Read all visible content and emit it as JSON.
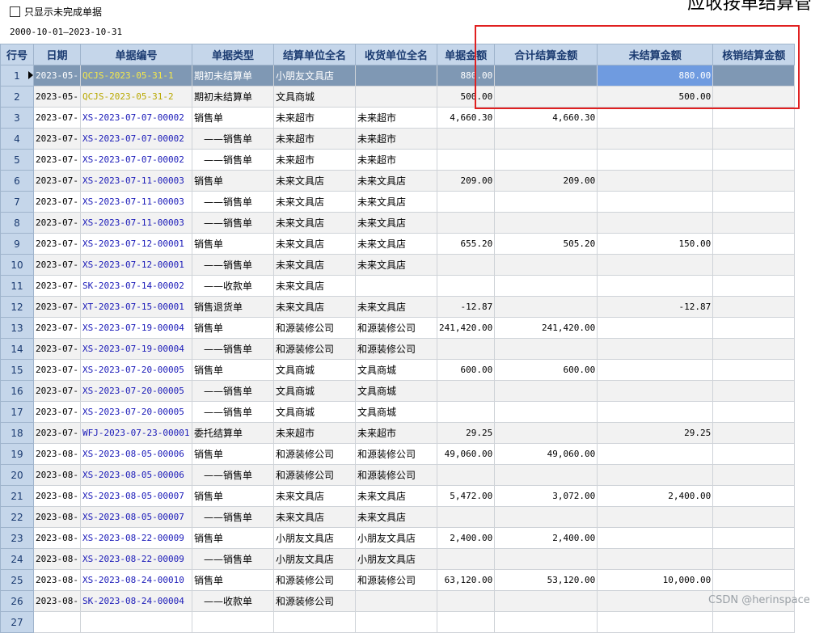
{
  "filter": {
    "checkbox_label": "只显示未完成单据",
    "checked": false,
    "date_range": "2000-10-01—2023-10-31"
  },
  "page_title_partial": "应收按单结算管",
  "columns": [
    "行号",
    "日期",
    "单据编号",
    "单据类型",
    "结算单位全名",
    "收货单位全名",
    "单据金额",
    "合计结算金额",
    "未结算金额",
    "核销结算金额"
  ],
  "rows": [
    {
      "n": "1",
      "date": "2023-05-",
      "code": "QCJS-2023-05-31-1",
      "type": "期初未结算单",
      "unit": "小朋友文具店",
      "recv": "",
      "amount": "880.00",
      "settled": "",
      "unsettled": "880.00",
      "writeoff": ""
    },
    {
      "n": "2",
      "date": "2023-05-",
      "code": "QCJS-2023-05-31-2",
      "type": "期初未结算单",
      "unit": "文具商城",
      "recv": "",
      "amount": "500.00",
      "settled": "",
      "unsettled": "500.00",
      "writeoff": ""
    },
    {
      "n": "3",
      "date": "2023-07-",
      "code": "XS-2023-07-07-00002",
      "type": "销售单",
      "unit": "未来超市",
      "recv": "未来超市",
      "amount": "4,660.30",
      "settled": "4,660.30",
      "unsettled": "",
      "writeoff": ""
    },
    {
      "n": "4",
      "date": "2023-07-",
      "code": "XS-2023-07-07-00002",
      "type": "——销售单",
      "unit": "未来超市",
      "recv": "未来超市",
      "amount": "",
      "settled": "",
      "unsettled": "",
      "writeoff": ""
    },
    {
      "n": "5",
      "date": "2023-07-",
      "code": "XS-2023-07-07-00002",
      "type": "——销售单",
      "unit": "未来超市",
      "recv": "未来超市",
      "amount": "",
      "settled": "",
      "unsettled": "",
      "writeoff": ""
    },
    {
      "n": "6",
      "date": "2023-07-",
      "code": "XS-2023-07-11-00003",
      "type": "销售单",
      "unit": "未来文具店",
      "recv": "未来文具店",
      "amount": "209.00",
      "settled": "209.00",
      "unsettled": "",
      "writeoff": ""
    },
    {
      "n": "7",
      "date": "2023-07-",
      "code": "XS-2023-07-11-00003",
      "type": "——销售单",
      "unit": "未来文具店",
      "recv": "未来文具店",
      "amount": "",
      "settled": "",
      "unsettled": "",
      "writeoff": ""
    },
    {
      "n": "8",
      "date": "2023-07-",
      "code": "XS-2023-07-11-00003",
      "type": "——销售单",
      "unit": "未来文具店",
      "recv": "未来文具店",
      "amount": "",
      "settled": "",
      "unsettled": "",
      "writeoff": ""
    },
    {
      "n": "9",
      "date": "2023-07-",
      "code": "XS-2023-07-12-00001",
      "type": "销售单",
      "unit": "未来文具店",
      "recv": "未来文具店",
      "amount": "655.20",
      "settled": "505.20",
      "unsettled": "150.00",
      "writeoff": ""
    },
    {
      "n": "10",
      "date": "2023-07-",
      "code": "XS-2023-07-12-00001",
      "type": "——销售单",
      "unit": "未来文具店",
      "recv": "未来文具店",
      "amount": "",
      "settled": "",
      "unsettled": "",
      "writeoff": ""
    },
    {
      "n": "11",
      "date": "2023-07-",
      "code": "SK-2023-07-14-00002",
      "type": "——收款单",
      "unit": "未来文具店",
      "recv": "",
      "amount": "",
      "settled": "",
      "unsettled": "",
      "writeoff": ""
    },
    {
      "n": "12",
      "date": "2023-07-",
      "code": "XT-2023-07-15-00001",
      "type": "销售退货单",
      "unit": "未来文具店",
      "recv": "未来文具店",
      "amount": "-12.87",
      "settled": "",
      "unsettled": "-12.87",
      "writeoff": ""
    },
    {
      "n": "13",
      "date": "2023-07-",
      "code": "XS-2023-07-19-00004",
      "type": "销售单",
      "unit": "和源装修公司",
      "recv": "和源装修公司",
      "amount": "241,420.00",
      "settled": "241,420.00",
      "unsettled": "",
      "writeoff": ""
    },
    {
      "n": "14",
      "date": "2023-07-",
      "code": "XS-2023-07-19-00004",
      "type": "——销售单",
      "unit": "和源装修公司",
      "recv": "和源装修公司",
      "amount": "",
      "settled": "",
      "unsettled": "",
      "writeoff": ""
    },
    {
      "n": "15",
      "date": "2023-07-",
      "code": "XS-2023-07-20-00005",
      "type": "销售单",
      "unit": "文具商城",
      "recv": "文具商城",
      "amount": "600.00",
      "settled": "600.00",
      "unsettled": "",
      "writeoff": ""
    },
    {
      "n": "16",
      "date": "2023-07-",
      "code": "XS-2023-07-20-00005",
      "type": "——销售单",
      "unit": "文具商城",
      "recv": "文具商城",
      "amount": "",
      "settled": "",
      "unsettled": "",
      "writeoff": ""
    },
    {
      "n": "17",
      "date": "2023-07-",
      "code": "XS-2023-07-20-00005",
      "type": "——销售单",
      "unit": "文具商城",
      "recv": "文具商城",
      "amount": "",
      "settled": "",
      "unsettled": "",
      "writeoff": ""
    },
    {
      "n": "18",
      "date": "2023-07-",
      "code": "WFJ-2023-07-23-00001",
      "type": "委托结算单",
      "unit": "未来超市",
      "recv": "未来超市",
      "amount": "29.25",
      "settled": "",
      "unsettled": "29.25",
      "writeoff": ""
    },
    {
      "n": "19",
      "date": "2023-08-",
      "code": "XS-2023-08-05-00006",
      "type": "销售单",
      "unit": "和源装修公司",
      "recv": "和源装修公司",
      "amount": "49,060.00",
      "settled": "49,060.00",
      "unsettled": "",
      "writeoff": ""
    },
    {
      "n": "20",
      "date": "2023-08-",
      "code": "XS-2023-08-05-00006",
      "type": "——销售单",
      "unit": "和源装修公司",
      "recv": "和源装修公司",
      "amount": "",
      "settled": "",
      "unsettled": "",
      "writeoff": ""
    },
    {
      "n": "21",
      "date": "2023-08-",
      "code": "XS-2023-08-05-00007",
      "type": "销售单",
      "unit": "未来文具店",
      "recv": "未来文具店",
      "amount": "5,472.00",
      "settled": "3,072.00",
      "unsettled": "2,400.00",
      "writeoff": ""
    },
    {
      "n": "22",
      "date": "2023-08-",
      "code": "XS-2023-08-05-00007",
      "type": "——销售单",
      "unit": "未来文具店",
      "recv": "未来文具店",
      "amount": "",
      "settled": "",
      "unsettled": "",
      "writeoff": ""
    },
    {
      "n": "23",
      "date": "2023-08-",
      "code": "XS-2023-08-22-00009",
      "type": "销售单",
      "unit": "小朋友文具店",
      "recv": "小朋友文具店",
      "amount": "2,400.00",
      "settled": "2,400.00",
      "unsettled": "",
      "writeoff": ""
    },
    {
      "n": "24",
      "date": "2023-08-",
      "code": "XS-2023-08-22-00009",
      "type": "——销售单",
      "unit": "小朋友文具店",
      "recv": "小朋友文具店",
      "amount": "",
      "settled": "",
      "unsettled": "",
      "writeoff": ""
    },
    {
      "n": "25",
      "date": "2023-08-",
      "code": "XS-2023-08-24-00010",
      "type": "销售单",
      "unit": "和源装修公司",
      "recv": "和源装修公司",
      "amount": "63,120.00",
      "settled": "53,120.00",
      "unsettled": "10,000.00",
      "writeoff": ""
    },
    {
      "n": "26",
      "date": "2023-08-",
      "code": "SK-2023-08-24-00004",
      "type": "——收款单",
      "unit": "和源装修公司",
      "recv": "",
      "amount": "",
      "settled": "",
      "unsettled": "",
      "writeoff": ""
    },
    {
      "n": "27",
      "date": "",
      "code": "",
      "type": "",
      "unit": "",
      "recv": "",
      "amount": "",
      "settled": "",
      "unsettled": "",
      "writeoff": ""
    }
  ],
  "selected_row": "1",
  "watermark": "CSDN @herinspace",
  "colors": {
    "header_bg": "#c5d6ea",
    "header_text": "#1a3a70",
    "selected_bg": "#7f98b4",
    "code_blue": "#1a1ab8",
    "code_yellow": "#b8a800",
    "highlight_box": "#e02020"
  }
}
